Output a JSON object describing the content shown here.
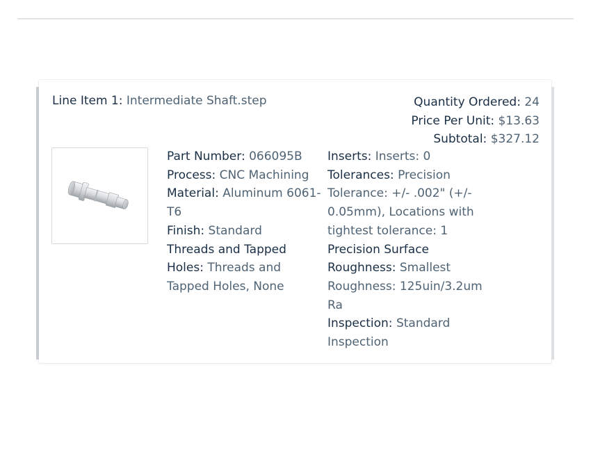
{
  "line_item": {
    "label": "Line Item 1:",
    "name": "Intermediate Shaft.step"
  },
  "summary": {
    "quantity_label": "Quantity Ordered:",
    "quantity_value": "24",
    "price_label": "Price Per Unit:",
    "price_value": "$13.63",
    "subtotal_label": "Subtotal:",
    "subtotal_value": "$327.12"
  },
  "part_image": {
    "icon": "shaft-part-icon"
  },
  "specs_left": [
    {
      "label": "Part Number:",
      "value": "066095B"
    },
    {
      "label": "Process:",
      "value": "CNC Machining"
    },
    {
      "label": "Material:",
      "value": "Aluminum 6061-T6"
    },
    {
      "label": "Finish:",
      "value": "Standard"
    },
    {
      "label": "Threads and Tapped Holes:",
      "value": "Threads and Tapped Holes, None"
    }
  ],
  "specs_right": [
    {
      "label": "Inserts:",
      "value": "Inserts: 0"
    },
    {
      "label": "Tolerances:",
      "value": "Precision Tolerance: +/- .002\" (+/- 0.05mm), Locations with tightest tolerance: 1"
    },
    {
      "label": "Precision Surface Roughness:",
      "value": "Smallest Roughness: 125uin/3.2um Ra"
    },
    {
      "label": "Inspection:",
      "value": "Standard Inspection"
    }
  ]
}
